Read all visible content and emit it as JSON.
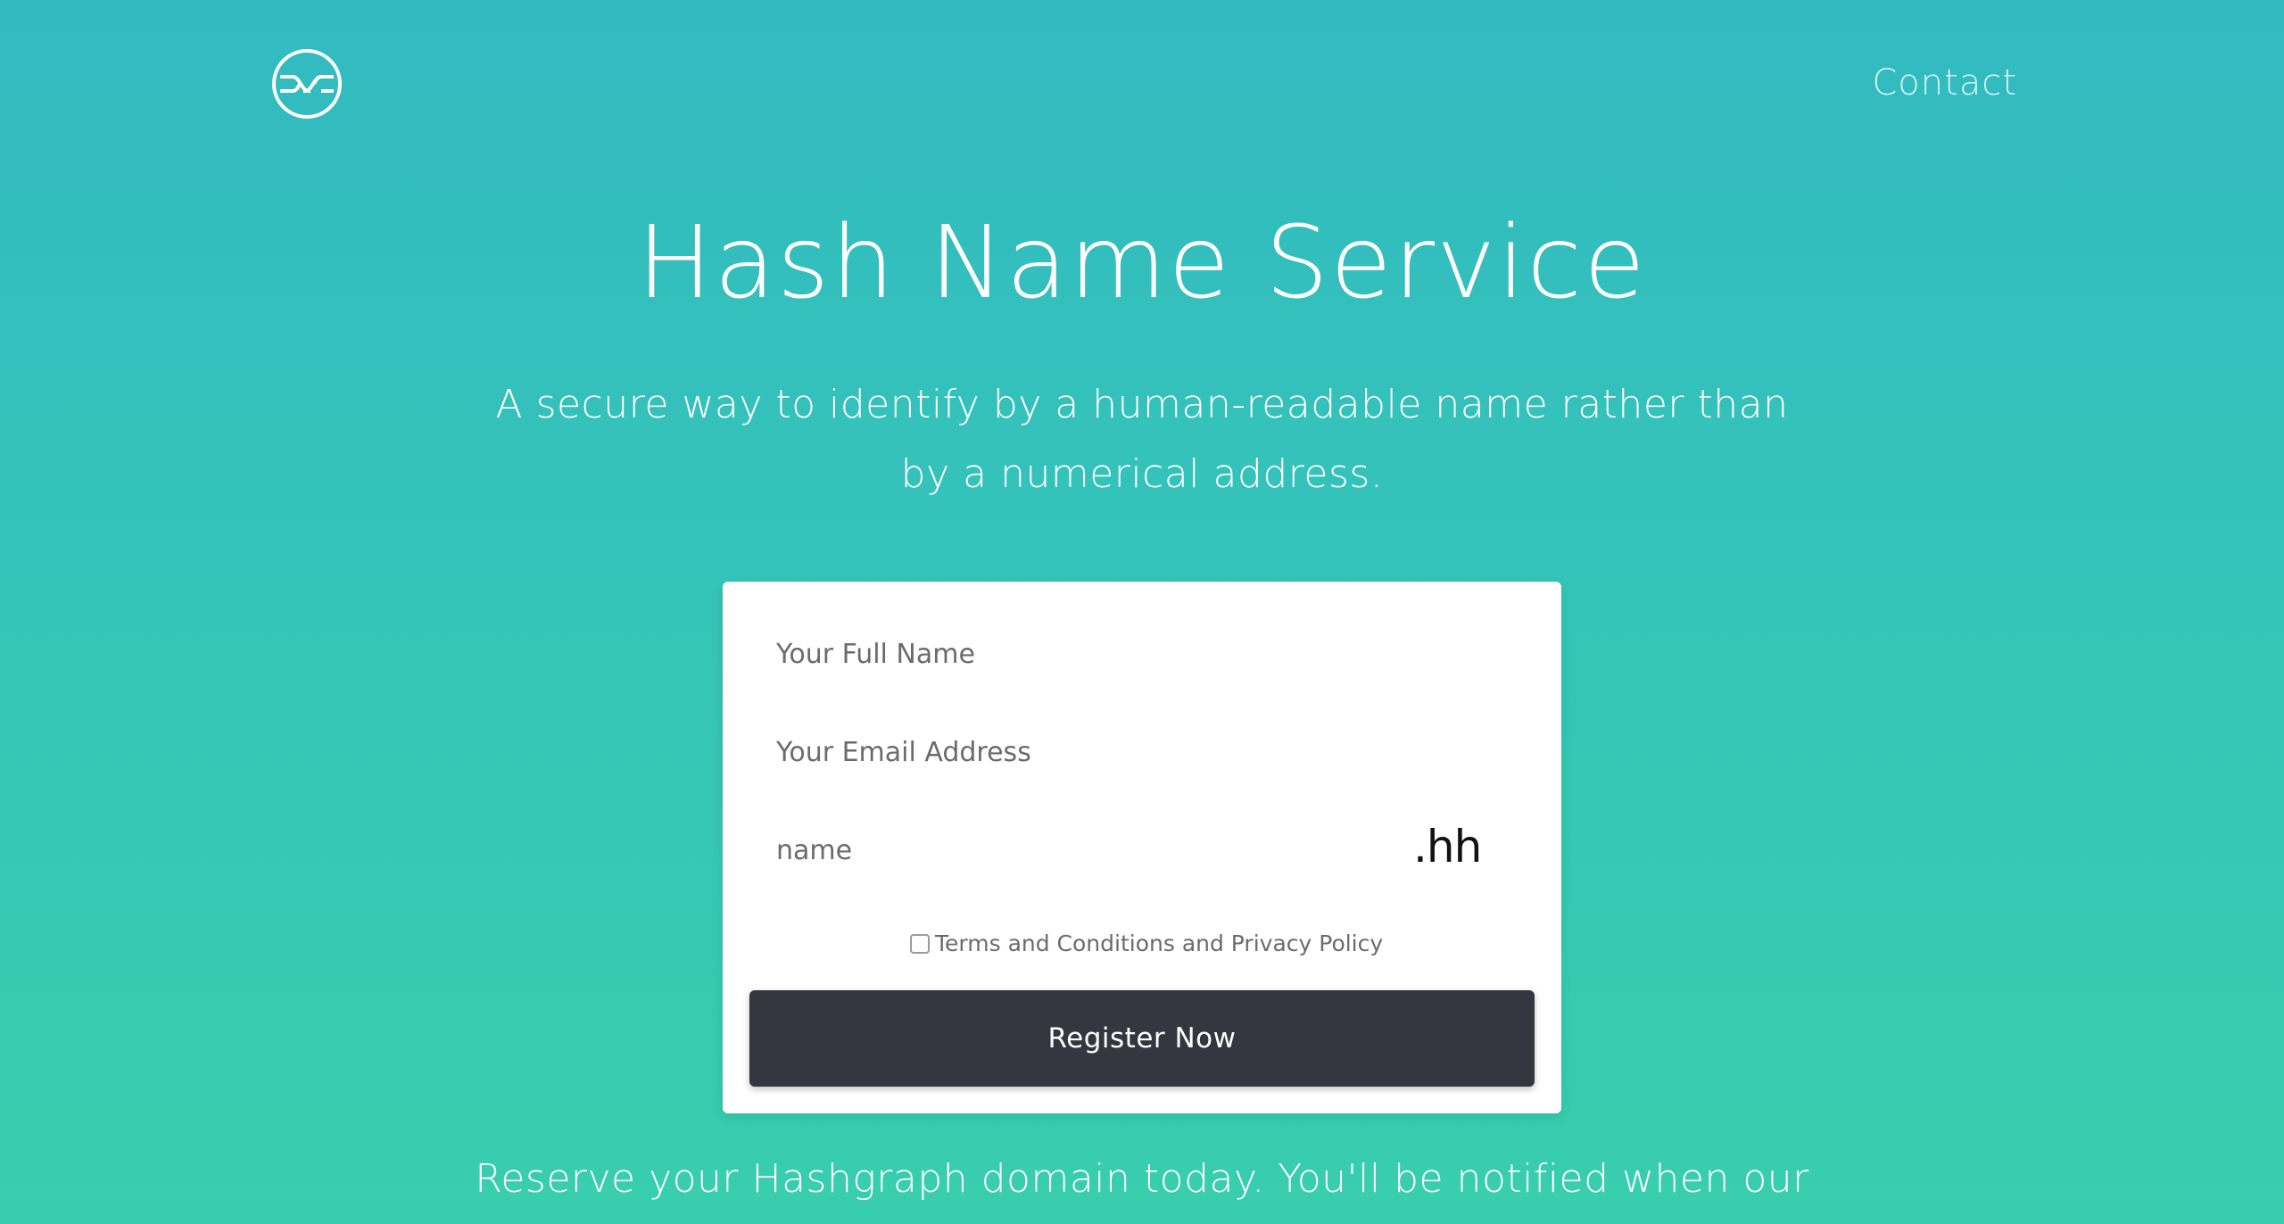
{
  "header": {
    "logo_icon": "hashgraph-logo-icon",
    "contact_label": "Contact"
  },
  "hero": {
    "title": "Hash Name Service",
    "subtitle": "A secure way to identify by a human-readable name rather than by a numerical address."
  },
  "form": {
    "full_name_placeholder": "Your Full Name",
    "email_placeholder": "Your Email Address",
    "domain_placeholder": "name",
    "domain_suffix": ".hh",
    "terms_label": "Terms and Conditions and Privacy Policy",
    "terms_checked": false,
    "submit_label": "Register Now"
  },
  "footer": {
    "text": "Reserve your Hashgraph domain today. You'll be notified when our"
  },
  "colors": {
    "background_top": "#32bac1",
    "background_bottom": "#38cead",
    "button": "#363640",
    "card": "#ffffff"
  }
}
